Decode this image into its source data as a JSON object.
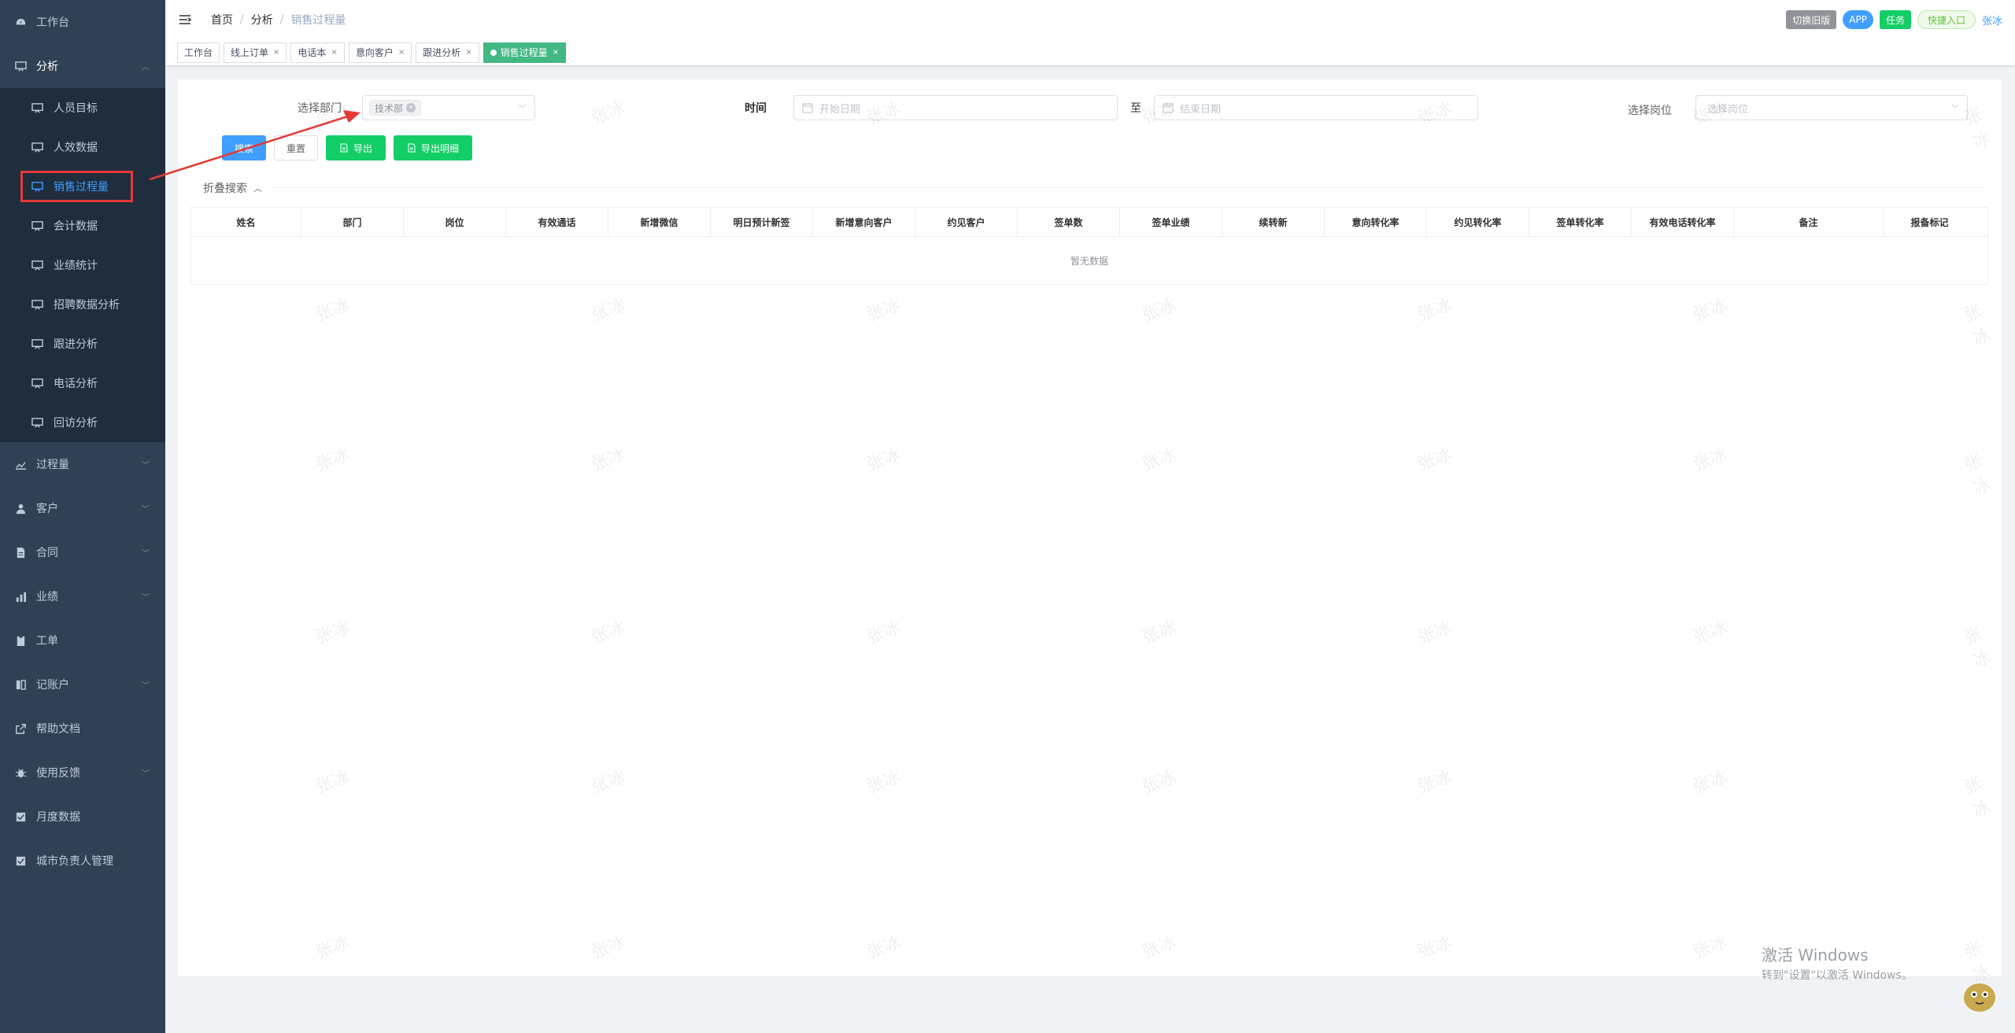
{
  "sidebar": {
    "workbench": "工作台",
    "analysis": "分析",
    "analysis_items": [
      "人员目标",
      "人效数据",
      "销售过程量",
      "会计数据",
      "业绩统计",
      "招聘数据分析",
      "跟进分析",
      "电话分析",
      "回访分析"
    ],
    "active_index": 2,
    "process": "过程量",
    "customer": "客户",
    "contract": "合同",
    "performance": "业绩",
    "workorder": "工单",
    "bookkeeping": "记账户",
    "help_docs": "帮助文档",
    "feedback": "使用反馈",
    "monthly": "月度数据",
    "city_manager": "城市负责人管理"
  },
  "header": {
    "breadcrumb": [
      "首页",
      "分析",
      "销售过程量"
    ],
    "switch_old": "切换旧版",
    "app": "APP",
    "task": "任务",
    "quick": "快捷入口",
    "user": "张冰"
  },
  "tags": [
    "工作台",
    "线上订单",
    "电话本",
    "意向客户",
    "跟进分析"
  ],
  "active_tag": "销售过程量",
  "form": {
    "dept_label": "选择部门",
    "dept_value": "技术部",
    "time_label": "时间",
    "start_placeholder": "开始日期",
    "to": "至",
    "end_placeholder": "结束日期",
    "position_label": "选择岗位",
    "position_placeholder": "选择岗位"
  },
  "buttons": {
    "search": "搜索",
    "reset": "重置",
    "export": "导出",
    "export_detail": "导出明细"
  },
  "collapse_label": "折叠搜索",
  "table": {
    "columns": [
      "姓名",
      "部门",
      "岗位",
      "有效通话",
      "新增微信",
      "明日预计新签",
      "新增意向客户",
      "约见客户",
      "签单数",
      "签单业绩",
      "续转新",
      "意向转化率",
      "约见转化率",
      "签单转化率",
      "有效电话转化率",
      "备注",
      "报备标记"
    ],
    "empty_text": "暂无数据"
  },
  "watermark_text": "张冰",
  "windows": {
    "line1": "激活 Windows",
    "line2": "转到\"设置\"以激活 Windows。"
  }
}
